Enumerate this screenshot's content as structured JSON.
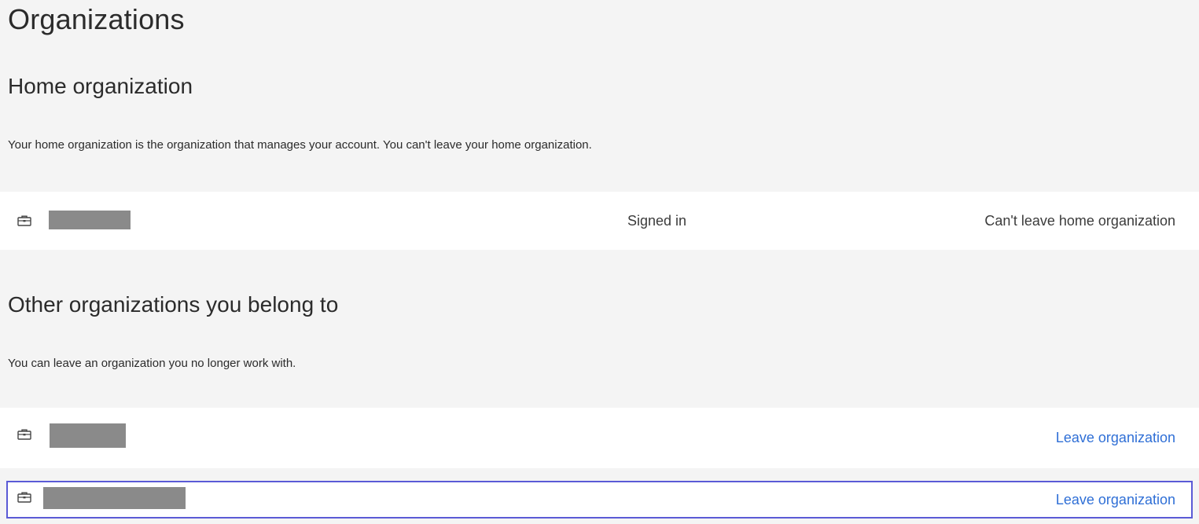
{
  "page": {
    "title": "Organizations"
  },
  "home_section": {
    "title": "Home organization",
    "description": "Your home organization is the organization that manages your account. You can't leave your home organization.",
    "org": {
      "icon": "briefcase-icon",
      "name_redacted": true,
      "status": "Signed in",
      "action": "Can't leave home organization"
    }
  },
  "other_section": {
    "title": "Other organizations you belong to",
    "description": "You can leave an organization you no longer work with.",
    "orgs": [
      {
        "icon": "briefcase-icon",
        "name_redacted": true,
        "action": "Leave organization",
        "selected": false
      },
      {
        "icon": "briefcase-icon",
        "name_redacted": true,
        "action": "Leave organization",
        "selected": true
      }
    ]
  },
  "colors": {
    "background": "#f4f4f4",
    "row_background": "#ffffff",
    "link": "#2f6fd6",
    "selection_border": "#5b5bd6",
    "redaction": "#8a8a8a"
  }
}
